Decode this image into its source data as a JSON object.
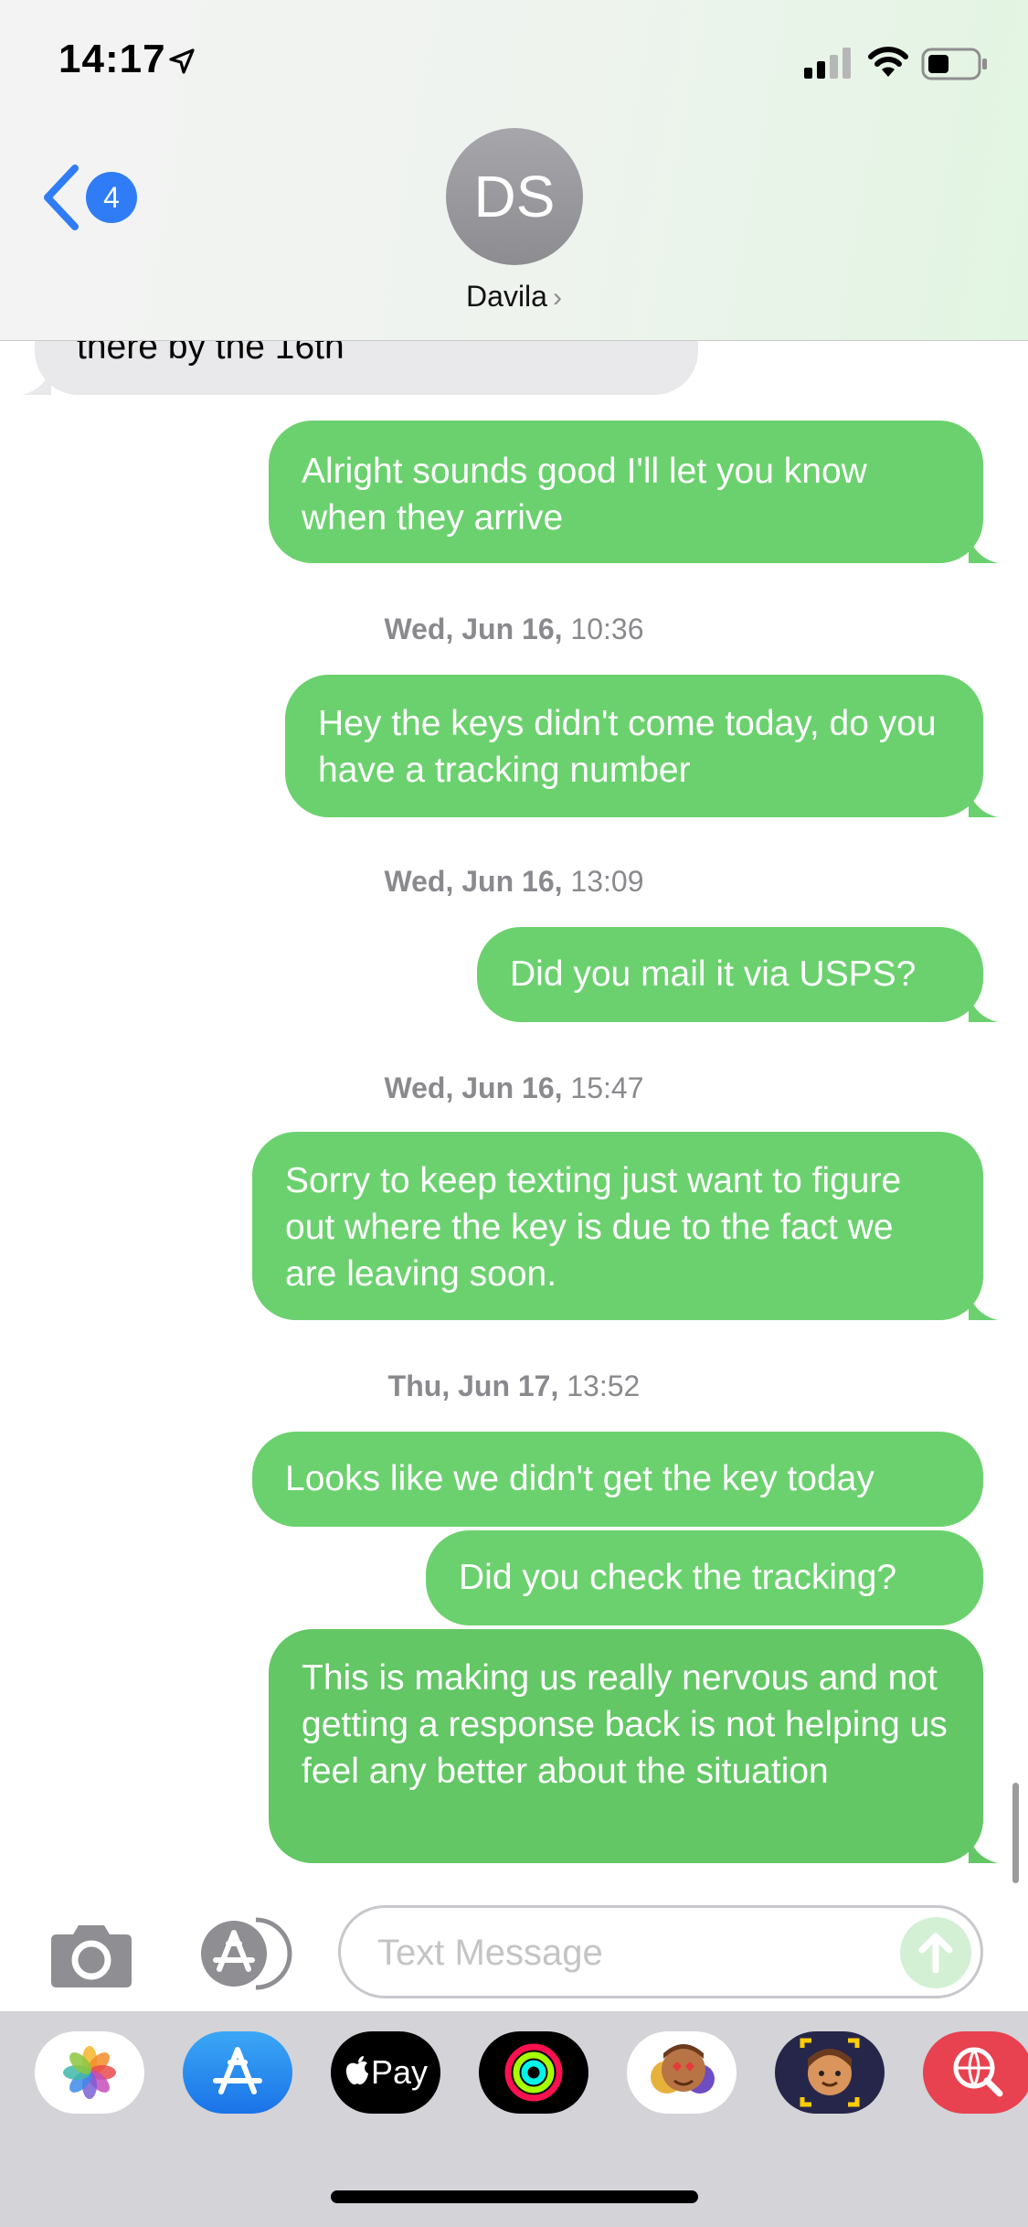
{
  "status_bar": {
    "time": "14:17"
  },
  "header": {
    "back_count": "4",
    "avatar_initials": "DS",
    "contact_name": "Davila"
  },
  "conversation": {
    "received_partial": "there by the 16th",
    "messages": [
      {
        "text": "Alright sounds good I'll let you know when they arrive"
      },
      {
        "stamp_day": "Wed, Jun 16,",
        "stamp_time": "10:36"
      },
      {
        "text": "Hey the keys didn't come today, do you have a tracking number"
      },
      {
        "stamp_day": "Wed, Jun 16,",
        "stamp_time": "13:09"
      },
      {
        "text": "Did you mail it via USPS?"
      },
      {
        "stamp_day": "Wed, Jun 16,",
        "stamp_time": "15:47"
      },
      {
        "text": "Sorry to keep texting just want to figure out where the key is due to the fact we are leaving soon."
      },
      {
        "stamp_day": "Thu, Jun 17,",
        "stamp_time": "13:52"
      },
      {
        "text": "Looks like we didn't get the key today"
      },
      {
        "text": "Did you check the tracking?"
      },
      {
        "text": "This is making us really nervous and not getting a response back is not helping us feel any better about the situation"
      }
    ]
  },
  "compose": {
    "placeholder": "Text Message",
    "value": ""
  },
  "app_drawer": {
    "apps": [
      {
        "icon": "photos-icon"
      },
      {
        "icon": "app-store-icon"
      },
      {
        "icon": "apple-pay-icon",
        "label": "Pay"
      },
      {
        "icon": "activity-icon"
      },
      {
        "icon": "animoji-icon"
      },
      {
        "icon": "memoji-icon"
      },
      {
        "icon": "web-search-icon"
      }
    ]
  },
  "colors": {
    "sent_bubble": "#6bd16e",
    "received_bubble": "#e9e9eb",
    "accent": "#2f7cf6",
    "stamp_text": "#8a8a8e"
  }
}
